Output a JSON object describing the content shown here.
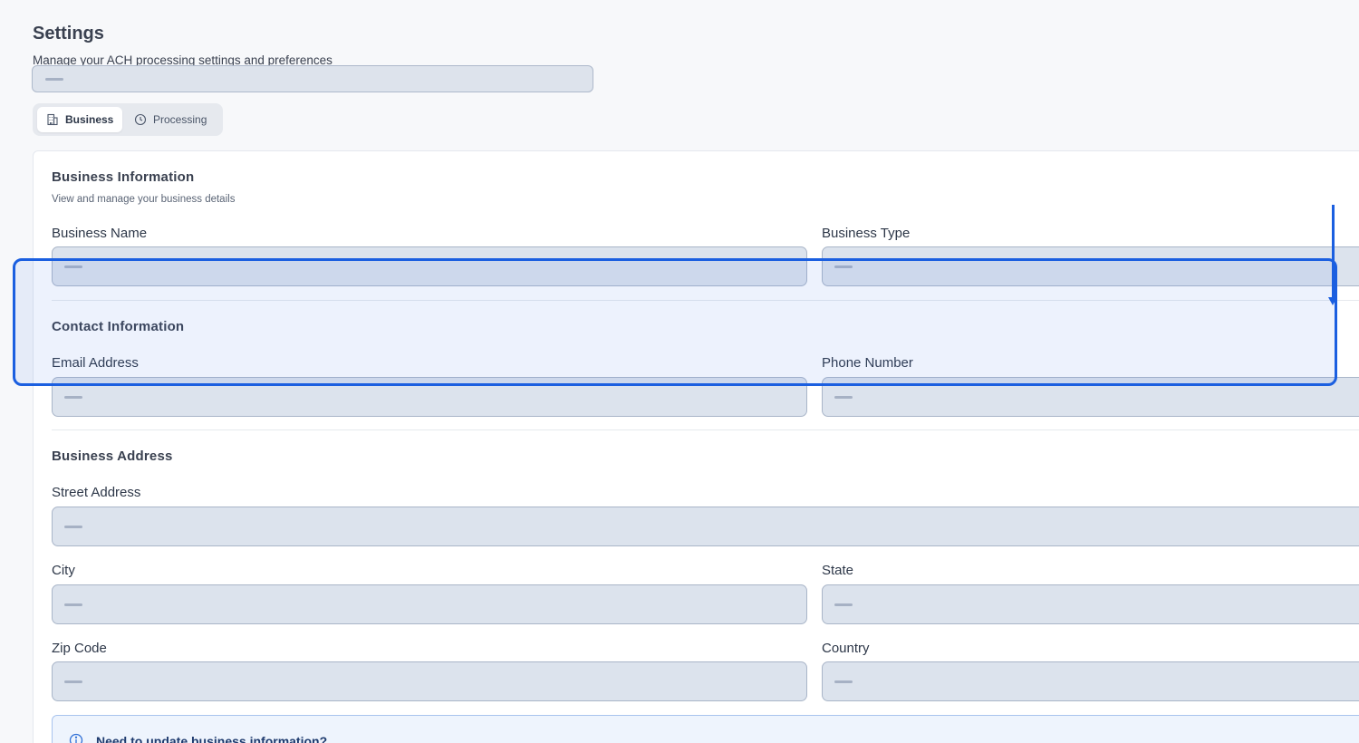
{
  "header": {
    "title": "Settings",
    "subtitle": "Manage your ACH processing settings and preferences"
  },
  "tabs": [
    {
      "label": "Business",
      "icon": "building-icon",
      "active": true
    },
    {
      "label": "Processing",
      "icon": "clock-icon",
      "active": false
    }
  ],
  "business_information": {
    "title": "Business Information",
    "description": "View and manage your business details",
    "business_name_label": "Business Name",
    "business_type_label": "Business Type"
  },
  "contact_information": {
    "title": "Contact Information",
    "email_label": "Email Address",
    "phone_label": "Phone Number"
  },
  "business_address": {
    "title": "Business Address",
    "street_label": "Street Address",
    "city_label": "City",
    "state_label": "State",
    "zip_label": "Zip Code",
    "country_label": "Country"
  },
  "notice": {
    "title": "Need to update business information?",
    "icon": "info-icon"
  },
  "colors": {
    "accent": "#1b5fe0",
    "field_bg": "#dce3ed",
    "field_border": "#a9b5c8"
  }
}
